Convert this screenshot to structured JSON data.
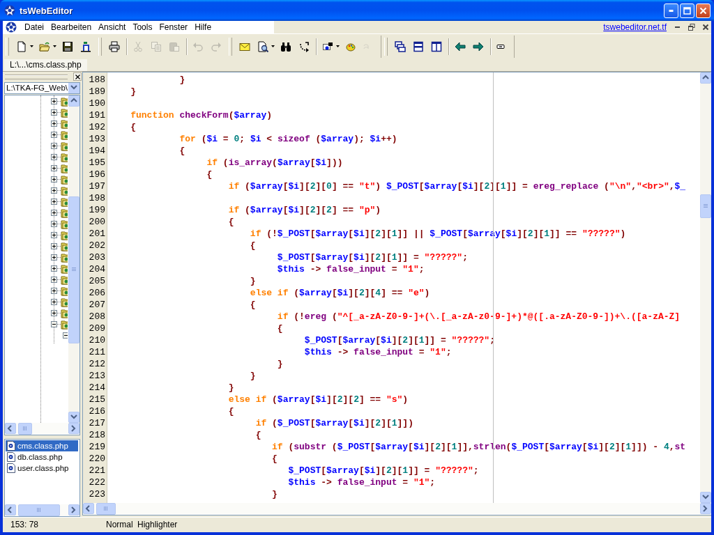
{
  "window": {
    "title": "tsWebEditor"
  },
  "menu": [
    "Datei",
    "Bearbeiten",
    "Ansicht",
    "Tools",
    "Fenster",
    "Hilfe"
  ],
  "menu_link": "tswebeditor.net.tf",
  "toolbar": [
    {
      "disabled": false
    },
    {
      "disabled": false
    },
    {
      "disabled": false
    },
    {
      "disabled": false
    },
    {
      "disabled": false
    },
    {
      "disabled": true
    },
    {
      "disabled": true
    },
    {
      "disabled": true
    },
    {
      "disabled": true
    },
    {
      "disabled": true
    },
    {
      "disabled": false
    },
    {
      "disabled": false
    },
    {
      "disabled": false
    },
    {
      "disabled": false
    },
    {
      "disabled": false
    },
    {
      "disabled": false
    },
    {
      "disabled": true
    },
    {
      "disabled": false
    },
    {
      "disabled": false
    },
    {
      "disabled": false
    },
    {
      "disabled": false
    },
    {
      "disabled": false
    },
    {
      "disabled": false
    }
  ],
  "tabs": [
    {
      "label": "L:\\...\\cms.class.php",
      "selected": true
    }
  ],
  "folder_combo": {
    "value": "L:\\TKA-FG_Web\\"
  },
  "tree": [
    {
      "expanded": false
    },
    {
      "expanded": false
    },
    {
      "expanded": false
    },
    {
      "expanded": false
    },
    {
      "expanded": false
    },
    {
      "expanded": false
    },
    {
      "expanded": false
    },
    {
      "expanded": false
    },
    {
      "expanded": false
    },
    {
      "expanded": false
    },
    {
      "expanded": false
    },
    {
      "expanded": false
    },
    {
      "expanded": false
    },
    {
      "expanded": false
    },
    {
      "expanded": false
    },
    {
      "expanded": false
    },
    {
      "expanded": false
    },
    {
      "expanded": false
    },
    {
      "expanded": false
    },
    {
      "expanded": false
    },
    {
      "expanded": true,
      "children": [
        {
          "expanded": true
        }
      ]
    }
  ],
  "files": [
    {
      "name": "cms.class.php",
      "selected": true
    },
    {
      "name": "db.class.php",
      "selected": false
    },
    {
      "name": "user.class.php",
      "selected": false
    }
  ],
  "editor": {
    "lines": [
      {
        "number": "188",
        "tokens": [
          {
            "kind": "symbol",
            "text": "             }"
          }
        ]
      },
      {
        "number": "189",
        "tokens": [
          {
            "kind": "symbol",
            "text": "    }"
          }
        ]
      },
      {
        "number": "190"
      },
      {
        "number": "191",
        "tokens": [
          {
            "kind": "keyword",
            "text": "    function"
          },
          {
            "kind": "function",
            "text": " checkForm"
          },
          {
            "kind": "symbol",
            "text": "("
          },
          {
            "kind": "variable",
            "text": "$array"
          },
          {
            "kind": "symbol",
            "text": ")"
          }
        ]
      },
      {
        "number": "192",
        "tokens": [
          {
            "kind": "symbol",
            "text": "    {"
          }
        ]
      },
      {
        "number": "193",
        "tokens": [
          {
            "kind": "keyword",
            "text": "             for"
          },
          {
            "kind": "symbol",
            "text": " ("
          },
          {
            "kind": "variable",
            "text": "$i"
          },
          {
            "kind": "symbol",
            "text": " = "
          },
          {
            "kind": "number",
            "text": "0"
          },
          {
            "kind": "symbol",
            "text": "; "
          },
          {
            "kind": "variable",
            "text": "$i"
          },
          {
            "kind": "symbol",
            "text": " < "
          },
          {
            "kind": "function",
            "text": "sizeof"
          },
          {
            "kind": "symbol",
            "text": " ("
          },
          {
            "kind": "variable",
            "text": "$array"
          },
          {
            "kind": "symbol",
            "text": "); "
          },
          {
            "kind": "variable",
            "text": "$i"
          },
          {
            "kind": "symbol",
            "text": "++)"
          }
        ]
      },
      {
        "number": "194",
        "tokens": [
          {
            "kind": "symbol",
            "text": "             {"
          }
        ]
      },
      {
        "number": "195",
        "tokens": [
          {
            "kind": "keyword",
            "text": "                  if"
          },
          {
            "kind": "symbol",
            "text": " ("
          },
          {
            "kind": "function",
            "text": "is_array"
          },
          {
            "kind": "symbol",
            "text": "("
          },
          {
            "kind": "variable",
            "text": "$array"
          },
          {
            "kind": "symbol",
            "text": "["
          },
          {
            "kind": "variable",
            "text": "$i"
          },
          {
            "kind": "symbol",
            "text": "]))"
          }
        ]
      },
      {
        "number": "196",
        "tokens": [
          {
            "kind": "symbol",
            "text": "                  {"
          }
        ]
      },
      {
        "number": "197",
        "tokens": [
          {
            "kind": "keyword",
            "text": "                      if"
          },
          {
            "kind": "symbol",
            "text": " ("
          },
          {
            "kind": "variable",
            "text": "$array"
          },
          {
            "kind": "symbol",
            "text": "["
          },
          {
            "kind": "variable",
            "text": "$i"
          },
          {
            "kind": "symbol",
            "text": "]["
          },
          {
            "kind": "number",
            "text": "2"
          },
          {
            "kind": "symbol",
            "text": "]["
          },
          {
            "kind": "number",
            "text": "0"
          },
          {
            "kind": "symbol",
            "text": "] == "
          },
          {
            "kind": "string",
            "text": "\"t\""
          },
          {
            "kind": "symbol",
            "text": ") "
          },
          {
            "kind": "variable",
            "text": "$_POST"
          },
          {
            "kind": "symbol",
            "text": "["
          },
          {
            "kind": "variable",
            "text": "$array"
          },
          {
            "kind": "symbol",
            "text": "["
          },
          {
            "kind": "variable",
            "text": "$i"
          },
          {
            "kind": "symbol",
            "text": "]["
          },
          {
            "kind": "number",
            "text": "2"
          },
          {
            "kind": "symbol",
            "text": "]["
          },
          {
            "kind": "number",
            "text": "1"
          },
          {
            "kind": "symbol",
            "text": "]] = "
          },
          {
            "kind": "function",
            "text": "ereg_replace"
          },
          {
            "kind": "symbol",
            "text": " ("
          },
          {
            "kind": "string",
            "text": "\"\\n\""
          },
          {
            "kind": "symbol",
            "text": ","
          },
          {
            "kind": "string",
            "text": "\"<br>\""
          },
          {
            "kind": "symbol",
            "text": ","
          },
          {
            "kind": "variable",
            "text": "$_"
          }
        ]
      },
      {
        "number": "198"
      },
      {
        "number": "199",
        "tokens": [
          {
            "kind": "keyword",
            "text": "                      if"
          },
          {
            "kind": "symbol",
            "text": " ("
          },
          {
            "kind": "variable",
            "text": "$array"
          },
          {
            "kind": "symbol",
            "text": "["
          },
          {
            "kind": "variable",
            "text": "$i"
          },
          {
            "kind": "symbol",
            "text": "]["
          },
          {
            "kind": "number",
            "text": "2"
          },
          {
            "kind": "symbol",
            "text": "]["
          },
          {
            "kind": "number",
            "text": "2"
          },
          {
            "kind": "symbol",
            "text": "] == "
          },
          {
            "kind": "string",
            "text": "\"p\""
          },
          {
            "kind": "symbol",
            "text": ")"
          }
        ]
      },
      {
        "number": "200",
        "tokens": [
          {
            "kind": "symbol",
            "text": "                      {"
          }
        ]
      },
      {
        "number": "201",
        "tokens": [
          {
            "kind": "keyword",
            "text": "                          if"
          },
          {
            "kind": "symbol",
            "text": " (!"
          },
          {
            "kind": "variable",
            "text": "$_POST"
          },
          {
            "kind": "symbol",
            "text": "["
          },
          {
            "kind": "variable",
            "text": "$array"
          },
          {
            "kind": "symbol",
            "text": "["
          },
          {
            "kind": "variable",
            "text": "$i"
          },
          {
            "kind": "symbol",
            "text": "]["
          },
          {
            "kind": "number",
            "text": "2"
          },
          {
            "kind": "symbol",
            "text": "]["
          },
          {
            "kind": "number",
            "text": "1"
          },
          {
            "kind": "symbol",
            "text": "]] || "
          },
          {
            "kind": "variable",
            "text": "$_POST"
          },
          {
            "kind": "symbol",
            "text": "["
          },
          {
            "kind": "variable",
            "text": "$array"
          },
          {
            "kind": "symbol",
            "text": "["
          },
          {
            "kind": "variable",
            "text": "$i"
          },
          {
            "kind": "symbol",
            "text": "]["
          },
          {
            "kind": "number",
            "text": "2"
          },
          {
            "kind": "symbol",
            "text": "]["
          },
          {
            "kind": "number",
            "text": "1"
          },
          {
            "kind": "symbol",
            "text": "]] == "
          },
          {
            "kind": "string",
            "text": "\"?????\""
          },
          {
            "kind": "symbol",
            "text": ")"
          }
        ]
      },
      {
        "number": "202",
        "tokens": [
          {
            "kind": "symbol",
            "text": "                          {"
          }
        ]
      },
      {
        "number": "203",
        "tokens": [
          {
            "kind": "variable",
            "text": "                               $_POST"
          },
          {
            "kind": "symbol",
            "text": "["
          },
          {
            "kind": "variable",
            "text": "$array"
          },
          {
            "kind": "symbol",
            "text": "["
          },
          {
            "kind": "variable",
            "text": "$i"
          },
          {
            "kind": "symbol",
            "text": "]["
          },
          {
            "kind": "number",
            "text": "2"
          },
          {
            "kind": "symbol",
            "text": "]["
          },
          {
            "kind": "number",
            "text": "1"
          },
          {
            "kind": "symbol",
            "text": "]] = "
          },
          {
            "kind": "string",
            "text": "\"?????\""
          },
          {
            "kind": "symbol",
            "text": ";"
          }
        ]
      },
      {
        "number": "204",
        "tokens": [
          {
            "kind": "variable",
            "text": "                               $this"
          },
          {
            "kind": "symbol",
            "text": " -> "
          },
          {
            "kind": "function",
            "text": "false_input"
          },
          {
            "kind": "symbol",
            "text": " = "
          },
          {
            "kind": "string",
            "text": "\"1\""
          },
          {
            "kind": "symbol",
            "text": ";"
          }
        ]
      },
      {
        "number": "205",
        "tokens": [
          {
            "kind": "symbol",
            "text": "                          }"
          }
        ]
      },
      {
        "number": "206",
        "tokens": [
          {
            "kind": "keyword",
            "text": "                          else if"
          },
          {
            "kind": "symbol",
            "text": " ("
          },
          {
            "kind": "variable",
            "text": "$array"
          },
          {
            "kind": "symbol",
            "text": "["
          },
          {
            "kind": "variable",
            "text": "$i"
          },
          {
            "kind": "symbol",
            "text": "]["
          },
          {
            "kind": "number",
            "text": "2"
          },
          {
            "kind": "symbol",
            "text": "]["
          },
          {
            "kind": "number",
            "text": "4"
          },
          {
            "kind": "symbol",
            "text": "] == "
          },
          {
            "kind": "string",
            "text": "\"e\""
          },
          {
            "kind": "symbol",
            "text": ")"
          }
        ]
      },
      {
        "number": "207",
        "tokens": [
          {
            "kind": "symbol",
            "text": "                          {"
          }
        ]
      },
      {
        "number": "208",
        "tokens": [
          {
            "kind": "keyword",
            "text": "                               if"
          },
          {
            "kind": "symbol",
            "text": " (!"
          },
          {
            "kind": "function",
            "text": "ereg"
          },
          {
            "kind": "symbol",
            "text": " ("
          },
          {
            "kind": "string",
            "text": "\"^[_a-zA-Z0-9-]+(\\.[_a-zA-z0-9-]+)*@([.a-zA-Z0-9-])+\\.([a-zA-Z]"
          }
        ]
      },
      {
        "number": "209",
        "tokens": [
          {
            "kind": "symbol",
            "text": "                               {"
          }
        ]
      },
      {
        "number": "210",
        "tokens": [
          {
            "kind": "variable",
            "text": "                                    $_POST"
          },
          {
            "kind": "symbol",
            "text": "["
          },
          {
            "kind": "variable",
            "text": "$array"
          },
          {
            "kind": "symbol",
            "text": "["
          },
          {
            "kind": "variable",
            "text": "$i"
          },
          {
            "kind": "symbol",
            "text": "]["
          },
          {
            "kind": "number",
            "text": "2"
          },
          {
            "kind": "symbol",
            "text": "]["
          },
          {
            "kind": "number",
            "text": "1"
          },
          {
            "kind": "symbol",
            "text": "]] = "
          },
          {
            "kind": "string",
            "text": "\"?????\""
          },
          {
            "kind": "symbol",
            "text": ";"
          }
        ]
      },
      {
        "number": "211",
        "tokens": [
          {
            "kind": "variable",
            "text": "                                    $this"
          },
          {
            "kind": "symbol",
            "text": " -> "
          },
          {
            "kind": "function",
            "text": "false_input"
          },
          {
            "kind": "symbol",
            "text": " = "
          },
          {
            "kind": "string",
            "text": "\"1\""
          },
          {
            "kind": "symbol",
            "text": ";"
          }
        ]
      },
      {
        "number": "212",
        "tokens": [
          {
            "kind": "symbol",
            "text": "                               }"
          }
        ]
      },
      {
        "number": "213",
        "tokens": [
          {
            "kind": "symbol",
            "text": "                          }"
          }
        ]
      },
      {
        "number": "214",
        "tokens": [
          {
            "kind": "symbol",
            "text": "                      }"
          }
        ]
      },
      {
        "number": "215",
        "tokens": [
          {
            "kind": "keyword",
            "text": "                      else if"
          },
          {
            "kind": "symbol",
            "text": " ("
          },
          {
            "kind": "variable",
            "text": "$array"
          },
          {
            "kind": "symbol",
            "text": "["
          },
          {
            "kind": "variable",
            "text": "$i"
          },
          {
            "kind": "symbol",
            "text": "]["
          },
          {
            "kind": "number",
            "text": "2"
          },
          {
            "kind": "symbol",
            "text": "]["
          },
          {
            "kind": "number",
            "text": "2"
          },
          {
            "kind": "symbol",
            "text": "] == "
          },
          {
            "kind": "string",
            "text": "\"s\""
          },
          {
            "kind": "symbol",
            "text": ")"
          }
        ]
      },
      {
        "number": "216",
        "tokens": [
          {
            "kind": "symbol",
            "text": "                      {"
          }
        ]
      },
      {
        "number": "217",
        "tokens": [
          {
            "kind": "keyword",
            "text": "                           if"
          },
          {
            "kind": "symbol",
            "text": " ("
          },
          {
            "kind": "variable",
            "text": "$_POST"
          },
          {
            "kind": "symbol",
            "text": "["
          },
          {
            "kind": "variable",
            "text": "$array"
          },
          {
            "kind": "symbol",
            "text": "["
          },
          {
            "kind": "variable",
            "text": "$i"
          },
          {
            "kind": "symbol",
            "text": "]["
          },
          {
            "kind": "number",
            "text": "2"
          },
          {
            "kind": "symbol",
            "text": "]["
          },
          {
            "kind": "number",
            "text": "1"
          },
          {
            "kind": "symbol",
            "text": "]])"
          }
        ]
      },
      {
        "number": "218",
        "tokens": [
          {
            "kind": "symbol",
            "text": "                           {"
          }
        ]
      },
      {
        "number": "219",
        "tokens": [
          {
            "kind": "keyword",
            "text": "                              if"
          },
          {
            "kind": "symbol",
            "text": " ("
          },
          {
            "kind": "function",
            "text": "substr"
          },
          {
            "kind": "symbol",
            "text": " ("
          },
          {
            "kind": "variable",
            "text": "$_POST"
          },
          {
            "kind": "symbol",
            "text": "["
          },
          {
            "kind": "variable",
            "text": "$array"
          },
          {
            "kind": "symbol",
            "text": "["
          },
          {
            "kind": "variable",
            "text": "$i"
          },
          {
            "kind": "symbol",
            "text": "]["
          },
          {
            "kind": "number",
            "text": "2"
          },
          {
            "kind": "symbol",
            "text": "]["
          },
          {
            "kind": "number",
            "text": "1"
          },
          {
            "kind": "symbol",
            "text": "]],"
          },
          {
            "kind": "function",
            "text": "strlen"
          },
          {
            "kind": "symbol",
            "text": "("
          },
          {
            "kind": "variable",
            "text": "$_POST"
          },
          {
            "kind": "symbol",
            "text": "["
          },
          {
            "kind": "variable",
            "text": "$array"
          },
          {
            "kind": "symbol",
            "text": "["
          },
          {
            "kind": "variable",
            "text": "$i"
          },
          {
            "kind": "symbol",
            "text": "]["
          },
          {
            "kind": "number",
            "text": "2"
          },
          {
            "kind": "symbol",
            "text": "]["
          },
          {
            "kind": "number",
            "text": "1"
          },
          {
            "kind": "symbol",
            "text": "]]) - "
          },
          {
            "kind": "number",
            "text": "4"
          },
          {
            "kind": "symbol",
            "text": ","
          },
          {
            "kind": "function",
            "text": "st"
          }
        ]
      },
      {
        "number": "220",
        "tokens": [
          {
            "kind": "symbol",
            "text": "                              {"
          }
        ]
      },
      {
        "number": "221",
        "tokens": [
          {
            "kind": "variable",
            "text": "                                 $_POST"
          },
          {
            "kind": "symbol",
            "text": "["
          },
          {
            "kind": "variable",
            "text": "$array"
          },
          {
            "kind": "symbol",
            "text": "["
          },
          {
            "kind": "variable",
            "text": "$i"
          },
          {
            "kind": "symbol",
            "text": "]["
          },
          {
            "kind": "number",
            "text": "2"
          },
          {
            "kind": "symbol",
            "text": "]["
          },
          {
            "kind": "number",
            "text": "1"
          },
          {
            "kind": "symbol",
            "text": "]] = "
          },
          {
            "kind": "string",
            "text": "\"?????\""
          },
          {
            "kind": "symbol",
            "text": ";"
          }
        ]
      },
      {
        "number": "222",
        "tokens": [
          {
            "kind": "variable",
            "text": "                                 $this"
          },
          {
            "kind": "symbol",
            "text": " -> "
          },
          {
            "kind": "function",
            "text": "false_input"
          },
          {
            "kind": "symbol",
            "text": " = "
          },
          {
            "kind": "string",
            "text": "\"1\""
          },
          {
            "kind": "symbol",
            "text": ";"
          }
        ]
      },
      {
        "number": "223",
        "tokens": [
          {
            "kind": "symbol",
            "text": "                              }"
          }
        ]
      }
    ]
  },
  "status_bar": {
    "position": "153: 78",
    "mode": "Normal",
    "highlighter": "Highlighter"
  }
}
